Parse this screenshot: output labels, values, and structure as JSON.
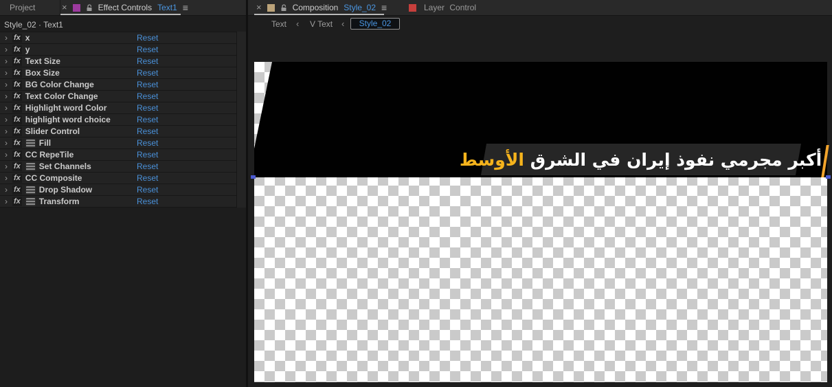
{
  "icons": {
    "close": "×",
    "menu": "≡",
    "chevron_left": "‹",
    "chevron_right": "›",
    "fx": "fx"
  },
  "left_panel": {
    "tabs": {
      "project_label": "Project",
      "title": "Effect Controls",
      "target": "Text1"
    },
    "subtitle": "Style_02 · Text1",
    "reset_label": "Reset",
    "effects": [
      {
        "name": "x",
        "badge": false
      },
      {
        "name": "y",
        "badge": false
      },
      {
        "name": "Text Size",
        "badge": false
      },
      {
        "name": "Box Size",
        "badge": false
      },
      {
        "name": "BG Color Change",
        "badge": false
      },
      {
        "name": "Text Color Change",
        "badge": false
      },
      {
        "name": "Highlight word Color",
        "badge": false
      },
      {
        "name": "highlight word choice",
        "badge": false
      },
      {
        "name": "Slider Control",
        "badge": false
      },
      {
        "name": "Fill",
        "badge": true
      },
      {
        "name": "CC RepeTile",
        "badge": false
      },
      {
        "name": "Set Channels",
        "badge": true
      },
      {
        "name": "CC Composite",
        "badge": false
      },
      {
        "name": "Drop Shadow",
        "badge": true
      },
      {
        "name": "Transform",
        "badge": true
      }
    ]
  },
  "right_panel": {
    "tabs": {
      "title": "Composition",
      "target": "Style_02",
      "layer_control_label": "Layer Control"
    },
    "breadcrumbs": {
      "items": [
        "Text",
        "V Text",
        "Style_02"
      ]
    },
    "composition": {
      "headline_text": "أكبر مجرمي نفوذ إيران في الشرق",
      "headline_highlight": "الأوسط"
    }
  },
  "colors": {
    "accent_blue": "#4b96e1",
    "reset_blue": "#4a90d8",
    "highlight_yellow": "#f5b31c",
    "project_chip_purple": "#9c3a9e",
    "comp_chip_tan": "#bba379",
    "layer_chip_red": "#c63f3c",
    "band_black": "#010101",
    "box_gray": "#262626"
  }
}
